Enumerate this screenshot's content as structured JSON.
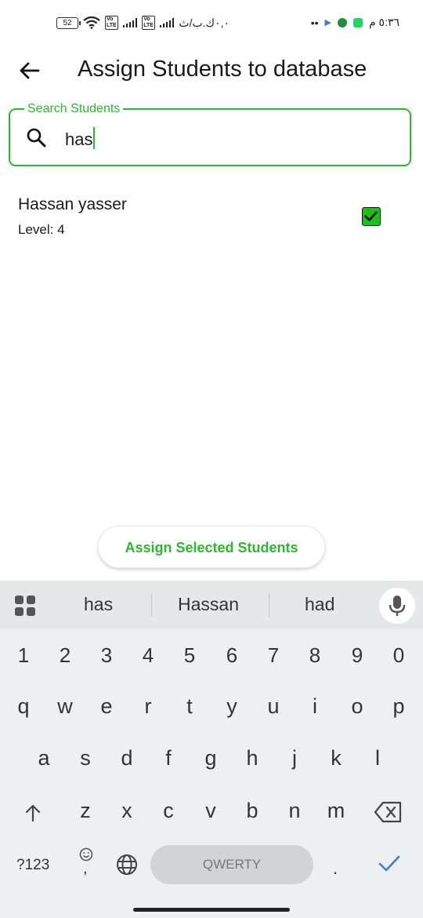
{
  "status_bar": {
    "battery": "52",
    "speed_text": "٠,٠ك.ب/ث",
    "time": "٥:٣٦ م",
    "dots": "••"
  },
  "app_bar": {
    "title": "Assign Students to database",
    "back_icon": "arrow-left-icon"
  },
  "search": {
    "label": "Search Students",
    "value": "has"
  },
  "students": [
    {
      "name": "Hassan yasser",
      "level": "Level: 4",
      "checked": true
    }
  ],
  "assign_button": {
    "label": "Assign Selected Students"
  },
  "keyboard": {
    "suggestions": [
      "has",
      "Hassan",
      "had"
    ],
    "number_row": [
      "1",
      "2",
      "3",
      "4",
      "5",
      "6",
      "7",
      "8",
      "9",
      "0"
    ],
    "row1": [
      "q",
      "w",
      "e",
      "r",
      "t",
      "y",
      "u",
      "i",
      "o",
      "p"
    ],
    "row2": [
      "a",
      "s",
      "d",
      "f",
      "g",
      "h",
      "j",
      "k",
      "l"
    ],
    "row3": [
      "z",
      "x",
      "c",
      "v",
      "b",
      "n",
      "m"
    ],
    "symbols_label": "?123",
    "comma": ",",
    "space_label": "QWERTY",
    "period": "."
  },
  "colors": {
    "accent": "#2fb52f",
    "checkbox": "#19c219",
    "keyboard_bg": "#eeeff1"
  }
}
